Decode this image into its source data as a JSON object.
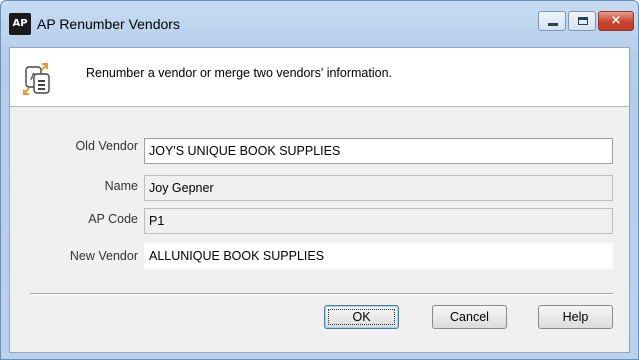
{
  "window": {
    "app_icon_text": "AP",
    "title": "AP Renumber Vendors",
    "controls": {
      "minimize": "minimize",
      "maximize": "maximize",
      "close": "×"
    }
  },
  "header": {
    "icon": "renumber-vendors-icon",
    "description": "Renumber a vendor or merge two vendors' information."
  },
  "form": {
    "old_vendor": {
      "label": "Old Vendor",
      "value": "JOY'S UNIQUE BOOK SUPPLIES"
    },
    "name": {
      "label": "Name",
      "value": "Joy Gepner"
    },
    "ap_code": {
      "label": "AP Code",
      "value": "P1"
    },
    "new_vendor": {
      "label": "New Vendor",
      "value": "ALLUNIQUE BOOK SUPPLIES"
    }
  },
  "buttons": {
    "ok": "OK",
    "cancel": "Cancel",
    "help": "Help"
  },
  "colors": {
    "titlebar": "#c6dcf3",
    "client": "#f0f0f0",
    "close_button": "#c9432e"
  }
}
